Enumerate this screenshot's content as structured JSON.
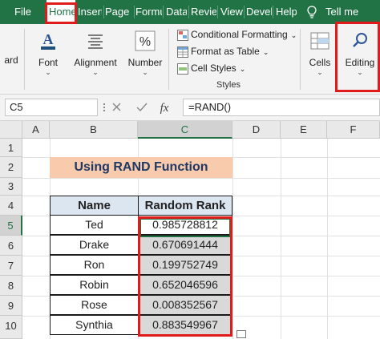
{
  "menu": {
    "items": [
      "File",
      "Home",
      "Insert",
      "Page L",
      "Formu",
      "Data",
      "Review",
      "View",
      "Develo",
      "Help"
    ],
    "tell_me": "Tell me"
  },
  "ribbon": {
    "clipboard_partial": "ard",
    "font": "Font",
    "alignment": "Alignment",
    "number": "Number",
    "conditional_formatting": "Conditional Formatting",
    "format_as_table": "Format as Table",
    "cell_styles": "Cell Styles",
    "styles_group": "Styles",
    "cells": "Cells",
    "editing": "Editing",
    "chevron": "⌄"
  },
  "formula_bar": {
    "name_box": "C5",
    "formula": "=RAND()",
    "fx": "fx"
  },
  "grid": {
    "columns": [
      "A",
      "B",
      "C",
      "D",
      "E",
      "F"
    ],
    "rows": [
      "1",
      "2",
      "3",
      "4",
      "5",
      "6",
      "7",
      "8",
      "9",
      "10"
    ],
    "selected_column": "C",
    "selected_row": "5"
  },
  "sheet": {
    "title": "Using RAND Function",
    "headers": [
      "Name",
      "Random Rank"
    ],
    "rows": [
      {
        "name": "Ted",
        "rank": "0.985728812"
      },
      {
        "name": "Drake",
        "rank": "0.670691444"
      },
      {
        "name": "Ron",
        "rank": "0.199752749"
      },
      {
        "name": "Robin",
        "rank": "0.652046596"
      },
      {
        "name": "Rose",
        "rank": "0.008352567"
      },
      {
        "name": "Synthia",
        "rank": "0.883549967"
      }
    ]
  },
  "colors": {
    "excel_green": "#217346",
    "highlight_red": "#e01b1b",
    "title_fill": "#f8cbad",
    "header_fill": "#dce6f1",
    "value_fill": "#d9d9d9"
  }
}
